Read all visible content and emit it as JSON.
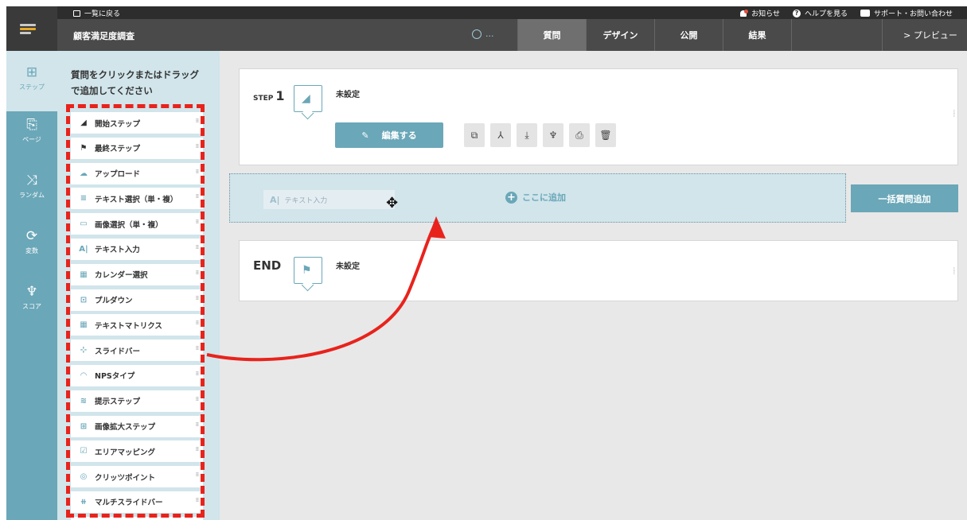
{
  "topbar": {
    "back_label": "一覧に戻る",
    "notice_label": "お知らせ",
    "help_label": "ヘルプを見る",
    "support_label": "サポート・お問い合わせ"
  },
  "header": {
    "title": "顧客満足度調査",
    "status_text": "...",
    "preview_label": "> プレビュー"
  },
  "tabs": [
    {
      "label": "質問"
    },
    {
      "label": "デザイン"
    },
    {
      "label": "公開"
    },
    {
      "label": "結果"
    }
  ],
  "leftnav": [
    {
      "label": "ステップ"
    },
    {
      "label": "ページ"
    },
    {
      "label": "ランダム"
    },
    {
      "label": "変数"
    },
    {
      "label": "スコア"
    }
  ],
  "palette": {
    "hint": "質問をクリックまたはドラッグで追加してください",
    "items": [
      {
        "label": "開始ステップ",
        "glyph": "◢"
      },
      {
        "label": "最終ステップ",
        "glyph": "⚑"
      },
      {
        "label": "アップロード",
        "glyph": "☁"
      },
      {
        "label": "テキスト選択（単・複）",
        "glyph": "≡"
      },
      {
        "label": "画像選択（単・複）",
        "glyph": "▭"
      },
      {
        "label": "テキスト入力",
        "glyph": "A|"
      },
      {
        "label": "カレンダー選択",
        "glyph": "▦"
      },
      {
        "label": "プルダウン",
        "glyph": "⊡"
      },
      {
        "label": "テキストマトリクス",
        "glyph": "▦"
      },
      {
        "label": "スライドバー",
        "glyph": "⊹"
      },
      {
        "label": "NPSタイプ",
        "glyph": "◠"
      },
      {
        "label": "提示ステップ",
        "glyph": "≋"
      },
      {
        "label": "画像拡大ステップ",
        "glyph": "⊞"
      },
      {
        "label": "エリアマッピング",
        "glyph": "☑"
      },
      {
        "label": "クリッツポイント",
        "glyph": "◎"
      },
      {
        "label": "マルチスライドバー",
        "glyph": "⧺"
      }
    ]
  },
  "step_card": {
    "step_prefix": "STEP",
    "step_number": "1",
    "unset_label": "未設定",
    "edit_label": "編集する"
  },
  "dropzone": {
    "chip_label": "テキスト入力",
    "add_label": "ここに追加"
  },
  "bulk_button": "一括質問追加",
  "end_card": {
    "label": "END",
    "unset_label": "未設定"
  },
  "colors": {
    "accent": "#6aa7b8",
    "highlight": "#e8231c",
    "dark": "#3a3a3a"
  }
}
